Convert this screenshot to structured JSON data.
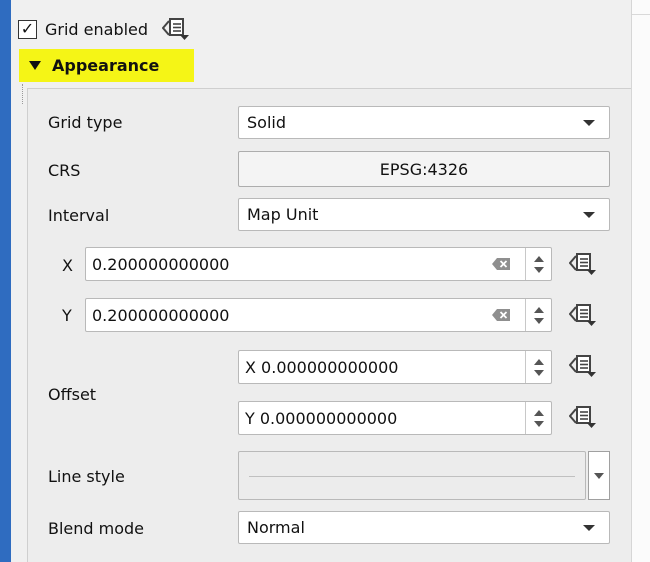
{
  "grid": {
    "enabled_label": "Grid enabled",
    "enabled_check": "✓",
    "checked": true
  },
  "section": {
    "title": "Appearance"
  },
  "fields": {
    "grid_type": {
      "label": "Grid type",
      "value": "Solid"
    },
    "crs": {
      "label": "CRS",
      "value": "EPSG:4326"
    },
    "interval": {
      "label": "Interval",
      "value": "Map Unit"
    },
    "x": {
      "label": "X",
      "value": "0.200000000000"
    },
    "y": {
      "label": "Y",
      "value": "0.200000000000"
    },
    "offset": {
      "label": "Offset",
      "x_value": "X 0.000000000000",
      "y_value": "Y 0.000000000000"
    },
    "line_style": {
      "label": "Line style"
    },
    "blend_mode": {
      "label": "Blend mode",
      "value": "Normal"
    }
  },
  "icons": {
    "data_defined": "data-defined-override-icon",
    "clear": "clear-text-icon",
    "dropdown": "chevron-down-icon",
    "spin_up": "spin-up-icon",
    "spin_down": "spin-down-icon"
  },
  "colors": {
    "highlight": "#f5f516",
    "frame_accent": "#2f6cc0"
  }
}
